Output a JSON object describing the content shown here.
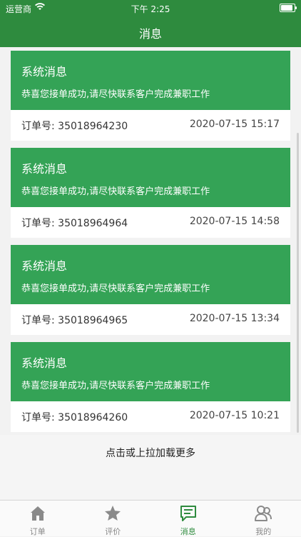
{
  "status_bar": {
    "carrier": "运营商",
    "time": "下午 2:25"
  },
  "navbar": {
    "title": "消息"
  },
  "messages": [
    {
      "title": "系统消息",
      "body": "恭喜您接单成功,请尽快联系客户完成兼职工作",
      "order_label": "订单号: 35018964230",
      "date": "2020-07-15 15:17"
    },
    {
      "title": "系统消息",
      "body": "恭喜您接单成功,请尽快联系客户完成兼职工作",
      "order_label": "订单号: 35018964964",
      "date": "2020-07-15 14:58"
    },
    {
      "title": "系统消息",
      "body": "恭喜您接单成功,请尽快联系客户完成兼职工作",
      "order_label": "订单号: 35018964965",
      "date": "2020-07-15 13:34"
    },
    {
      "title": "系统消息",
      "body": "恭喜您接单成功,请尽快联系客户完成兼职工作",
      "order_label": "订单号: 35018964260",
      "date": "2020-07-15 10:21"
    }
  ],
  "load_more": "点击或上拉加载更多",
  "tabs": [
    {
      "label": "订单",
      "icon": "home-icon"
    },
    {
      "label": "评价",
      "icon": "star-icon"
    },
    {
      "label": "消息",
      "icon": "message-icon",
      "active": true
    },
    {
      "label": "我的",
      "icon": "user-icon"
    }
  ],
  "colors": {
    "nav": "#2e8b3e",
    "card_header": "#34a356",
    "active_tab": "#2e8b3e",
    "inactive_tab": "#888888"
  }
}
